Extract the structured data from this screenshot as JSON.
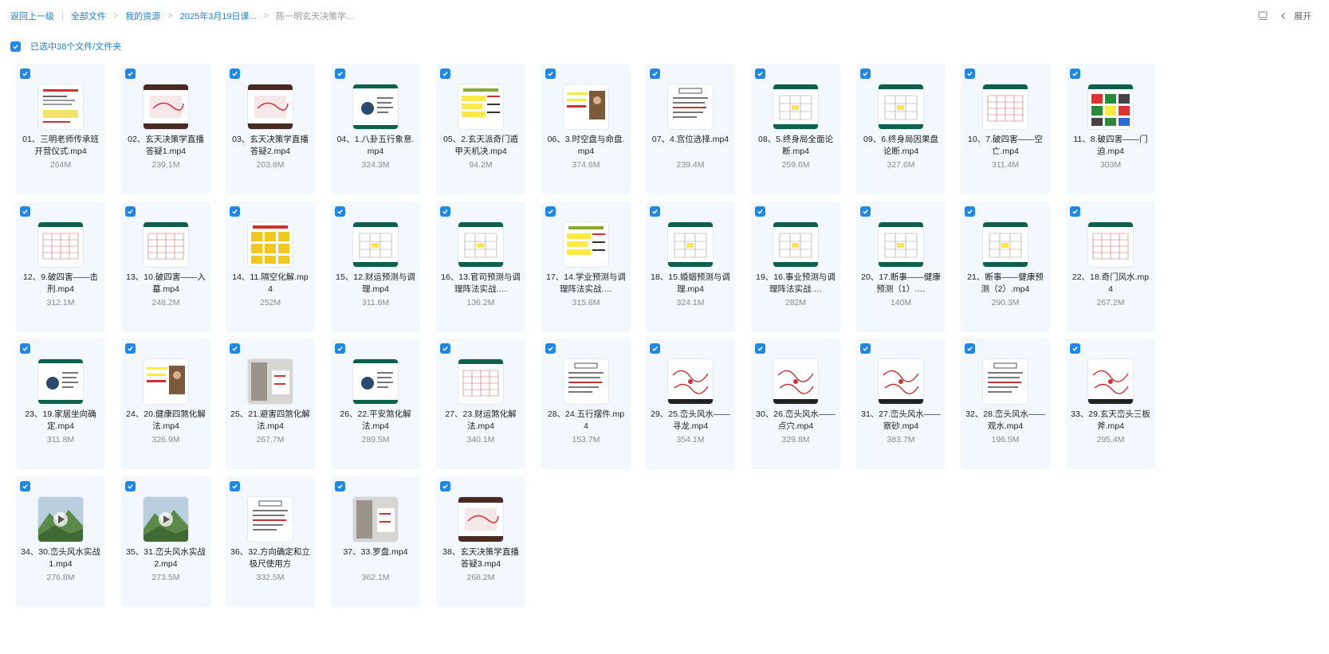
{
  "breadcrumb": {
    "back": "返回上一级",
    "items": [
      "全部文件",
      "我的资源",
      "2025年3月19日课...",
      "陈一明玄天决策学..."
    ]
  },
  "toolbar": {
    "expand_label": "展开"
  },
  "selection": {
    "label": "已选中38个文件/文件夹",
    "checked": true
  },
  "colors": {
    "accent": "#1e87e8",
    "card_bg": "#f2f8fd"
  },
  "files": [
    {
      "name": "01、三明老师传承班开营仪式.mp4",
      "size": "264M",
      "thumb": "doc-red"
    },
    {
      "name": "02、玄天决策学直播答疑1.mp4",
      "size": "239.1M",
      "thumb": "dark-pink"
    },
    {
      "name": "03、玄天决策学直播答疑2.mp4",
      "size": "203.8M",
      "thumb": "dark-pink"
    },
    {
      "name": "04、1.八卦五行象意.mp4",
      "size": "324.3M",
      "thumb": "teal-diagram"
    },
    {
      "name": "05、2.玄天派奇门遁甲天机决.mp4",
      "size": "94.2M",
      "thumb": "yellow-text"
    },
    {
      "name": "06、3.时空盘与命盘.mp4",
      "size": "374.6M",
      "thumb": "photo-brown"
    },
    {
      "name": "07、4.宫位选择.mp4",
      "size": "239.4M",
      "thumb": "doc-plain"
    },
    {
      "name": "08、5.终身局全面论断.mp4",
      "size": "259.6M",
      "thumb": "teal-table"
    },
    {
      "name": "09、6.终身局因果盘论断.mp4",
      "size": "327.6M",
      "thumb": "teal-table"
    },
    {
      "name": "10、7.破四害——空亡.mp4",
      "size": "311.4M",
      "thumb": "table-red"
    },
    {
      "name": "11、8.破四害——门迫.mp4",
      "size": "303M",
      "thumb": "color-table"
    },
    {
      "name": "12、9.破四害——击刑.mp4",
      "size": "312.1M",
      "thumb": "table-red"
    },
    {
      "name": "13、10.破四害——入墓.mp4",
      "size": "248.2M",
      "thumb": "table-red"
    },
    {
      "name": "14、11.隔空化解.mp4",
      "size": "252M",
      "thumb": "yellow-grid"
    },
    {
      "name": "15、12.财运预测与调理.mp4",
      "size": "311.8M",
      "thumb": "teal-table"
    },
    {
      "name": "16、13.官司预测与调理阵法实战.…",
      "size": "136.2M",
      "thumb": "teal-table"
    },
    {
      "name": "17、14.学业预测与调理阵法实战.…",
      "size": "315.8M",
      "thumb": "yellow-text"
    },
    {
      "name": "18、15.婚姻预测与调理.mp4",
      "size": "324.1M",
      "thumb": "teal-table"
    },
    {
      "name": "19、16.事业预测与调理阵法实战.…",
      "size": "282M",
      "thumb": "teal-table"
    },
    {
      "name": "20、17.断事——健康预测（1）.…",
      "size": "140M",
      "thumb": "teal-table"
    },
    {
      "name": "21、断事——健康预测（2）.mp4",
      "size": "290.3M",
      "thumb": "teal-table"
    },
    {
      "name": "22、18.奇门风水.mp4",
      "size": "267.2M",
      "thumb": "table-red"
    },
    {
      "name": "23、19.家居坐向确定.mp4",
      "size": "311.8M",
      "thumb": "teal-diagram"
    },
    {
      "name": "24、20.健康四煞化解法.mp4",
      "size": "326.9M",
      "thumb": "photo-brown"
    },
    {
      "name": "25、21.避害四煞化解法.mp4",
      "size": "267.7M",
      "thumb": "photo-grey"
    },
    {
      "name": "26、22.平安煞化解法.mp4",
      "size": "289.5M",
      "thumb": "teal-diagram"
    },
    {
      "name": "27、23.财运煞化解法.mp4",
      "size": "340.1M",
      "thumb": "table-red"
    },
    {
      "name": "28、24.五行摆件.mp4",
      "size": "153.7M",
      "thumb": "doc-plain"
    },
    {
      "name": "29、25.峦头风水——寻龙.mp4",
      "size": "354.1M",
      "thumb": "sketch-red"
    },
    {
      "name": "30、26.峦头风水——点穴.mp4",
      "size": "329.8M",
      "thumb": "sketch-red"
    },
    {
      "name": "31、27.峦头风水——察砂.mp4",
      "size": "383.7M",
      "thumb": "sketch-red"
    },
    {
      "name": "32、28.峦头风水——观水.mp4",
      "size": "196.5M",
      "thumb": "doc-plain"
    },
    {
      "name": "33、29.玄天峦头三板斧.mp4",
      "size": "295.4M",
      "thumb": "sketch-red"
    },
    {
      "name": "34、30.峦头风水实战1.mp4",
      "size": "276.8M",
      "thumb": "mountain"
    },
    {
      "name": "35、31.峦头风水实战2.mp4",
      "size": "273.5M",
      "thumb": "mountain"
    },
    {
      "name": "36、32.方向确定和立极尺使用方",
      "size": "332.5M",
      "thumb": "doc-plain"
    },
    {
      "name": "37、33.罗盘.mp4",
      "size": "362.1M",
      "thumb": "photo-grey"
    },
    {
      "name": "38、玄天决策学直播答疑3.mp4",
      "size": "268.2M",
      "thumb": "dark-pink"
    }
  ]
}
